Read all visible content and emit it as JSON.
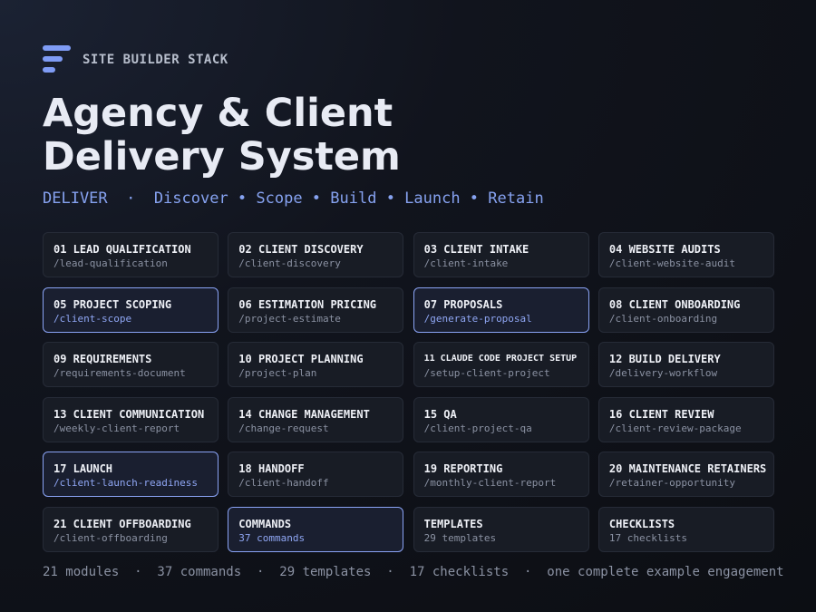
{
  "brand": {
    "name": "SITE BUILDER STACK",
    "logo_icon": "stacked-bars-logo-icon"
  },
  "title": {
    "line1": "Agency & Client",
    "line2": "Delivery System"
  },
  "tagline": "DELIVER  ·  Discover • Scope • Build • Launch • Retain",
  "colors": {
    "accent": "#86a2f0",
    "background": "#0f1117",
    "card": "#181c25",
    "highlight_border": "#8aa3f5"
  },
  "modules": [
    {
      "title": "01 LEAD QUALIFICATION",
      "sub": "/lead-qualification",
      "highlight": false
    },
    {
      "title": "02 CLIENT DISCOVERY",
      "sub": "/client-discovery",
      "highlight": false
    },
    {
      "title": "03 CLIENT INTAKE",
      "sub": "/client-intake",
      "highlight": false
    },
    {
      "title": "04 WEBSITE AUDITS",
      "sub": "/client-website-audit",
      "highlight": false
    },
    {
      "title": "05 PROJECT SCOPING",
      "sub": "/client-scope",
      "highlight": true
    },
    {
      "title": "06 ESTIMATION PRICING",
      "sub": "/project-estimate",
      "highlight": false
    },
    {
      "title": "07 PROPOSALS",
      "sub": "/generate-proposal",
      "highlight": true
    },
    {
      "title": "08 CLIENT ONBOARDING",
      "sub": "/client-onboarding",
      "highlight": false
    },
    {
      "title": "09 REQUIREMENTS",
      "sub": "/requirements-document",
      "highlight": false
    },
    {
      "title": "10 PROJECT PLANNING",
      "sub": "/project-plan",
      "highlight": false
    },
    {
      "title": "11 CLAUDE CODE PROJECT SETUP",
      "sub": "/setup-client-project",
      "highlight": false,
      "small": true
    },
    {
      "title": "12 BUILD DELIVERY",
      "sub": "/delivery-workflow",
      "highlight": false
    },
    {
      "title": "13 CLIENT COMMUNICATION",
      "sub": "/weekly-client-report",
      "highlight": false
    },
    {
      "title": "14 CHANGE MANAGEMENT",
      "sub": "/change-request",
      "highlight": false
    },
    {
      "title": "15 QA",
      "sub": "/client-project-qa",
      "highlight": false
    },
    {
      "title": "16 CLIENT REVIEW",
      "sub": "/client-review-package",
      "highlight": false
    },
    {
      "title": "17 LAUNCH",
      "sub": "/client-launch-readiness",
      "highlight": true
    },
    {
      "title": "18 HANDOFF",
      "sub": "/client-handoff",
      "highlight": false
    },
    {
      "title": "19 REPORTING",
      "sub": "/monthly-client-report",
      "highlight": false
    },
    {
      "title": "20 MAINTENANCE RETAINERS",
      "sub": "/retainer-opportunity",
      "highlight": false
    },
    {
      "title": "21 CLIENT OFFBOARDING",
      "sub": "/client-offboarding",
      "highlight": false
    },
    {
      "title": "COMMANDS",
      "sub": "37 commands",
      "highlight": true
    },
    {
      "title": "TEMPLATES",
      "sub": "29 templates",
      "highlight": false
    },
    {
      "title": "CHECKLISTS",
      "sub": "17 checklists",
      "highlight": false
    }
  ],
  "footer": "21 modules  ·  37 commands  ·  29 templates  ·  17 checklists  ·  one complete example engagement"
}
